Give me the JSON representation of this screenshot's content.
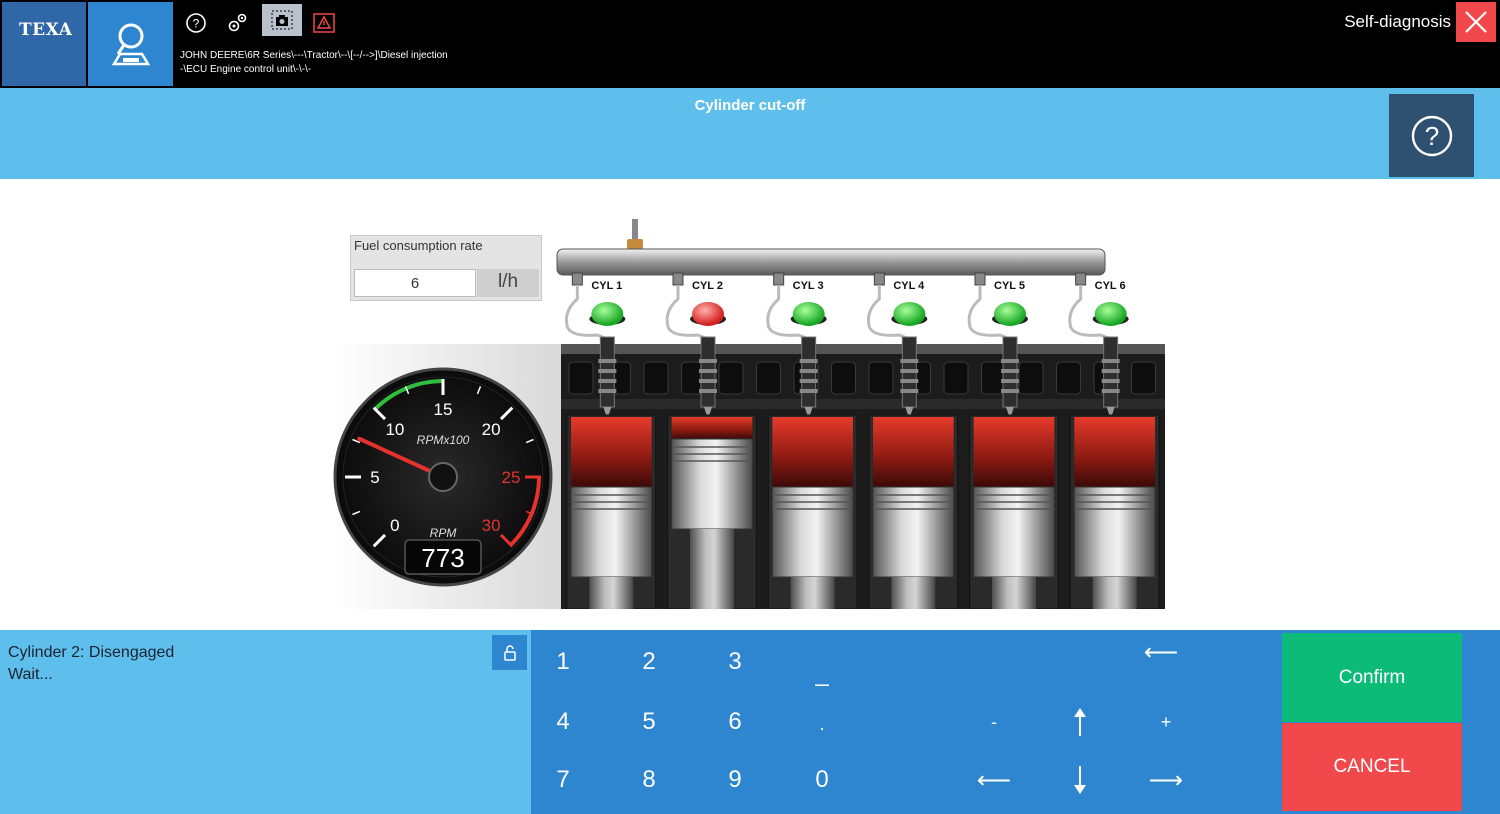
{
  "topbar": {
    "logo": "TEXA",
    "breadcrumb_line1": "JOHN DEERE\\6R Series\\---\\Tractor\\--\\[--/-->]\\Diesel injection",
    "breadcrumb_line2": "-\\ECU Engine control unit\\-\\-\\-",
    "mode_label": "Self-diagnosis",
    "icons": [
      "search-vehicle-icon",
      "help-circle-icon",
      "gears-icon",
      "screenshot-camera-icon",
      "warning-triangle-icon",
      "close-icon"
    ]
  },
  "titlebar": {
    "title": "Cylinder cut-off"
  },
  "fuel": {
    "label": "Fuel consumption rate",
    "value": "6",
    "unit": "l/h"
  },
  "gauge": {
    "scale_label": "RPMx100",
    "unit_label": "RPM",
    "value": "773",
    "needle_rpm_x100": 7.73,
    "ticks": [
      "0",
      "5",
      "10",
      "15",
      "20",
      "25",
      "30"
    ],
    "green_zone": [
      10,
      15
    ],
    "red_zone": [
      25,
      30
    ]
  },
  "cylinders": [
    {
      "label": "CYL 1",
      "state": "engaged"
    },
    {
      "label": "CYL 2",
      "state": "disengaged"
    },
    {
      "label": "CYL 3",
      "state": "engaged"
    },
    {
      "label": "CYL 4",
      "state": "engaged"
    },
    {
      "label": "CYL 5",
      "state": "engaged"
    },
    {
      "label": "CYL 6",
      "state": "engaged"
    }
  ],
  "colors": {
    "engaged": "#2fc93c",
    "disengaged": "#f0484b",
    "accent_blue": "#2d86cf",
    "light_blue": "#5fbfec",
    "confirm_green": "#0dbb79",
    "cancel_red": "#f0484b"
  },
  "status": {
    "line1": "Cylinder 2: Disengaged",
    "line2": "Wait..."
  },
  "keypad": {
    "k1": "1",
    "k2": "2",
    "k3": "3",
    "k4": "4",
    "k5": "5",
    "k6": "6",
    "k7": "7",
    "k8": "8",
    "k9": "9",
    "k0": "0",
    "underscore": "_",
    "dot": ".",
    "minus": "-",
    "plus": "+",
    "backspace": "⟵",
    "left": "⟵",
    "right": "⟶"
  },
  "actions": {
    "confirm": "Confirm",
    "cancel": "CANCEL"
  }
}
